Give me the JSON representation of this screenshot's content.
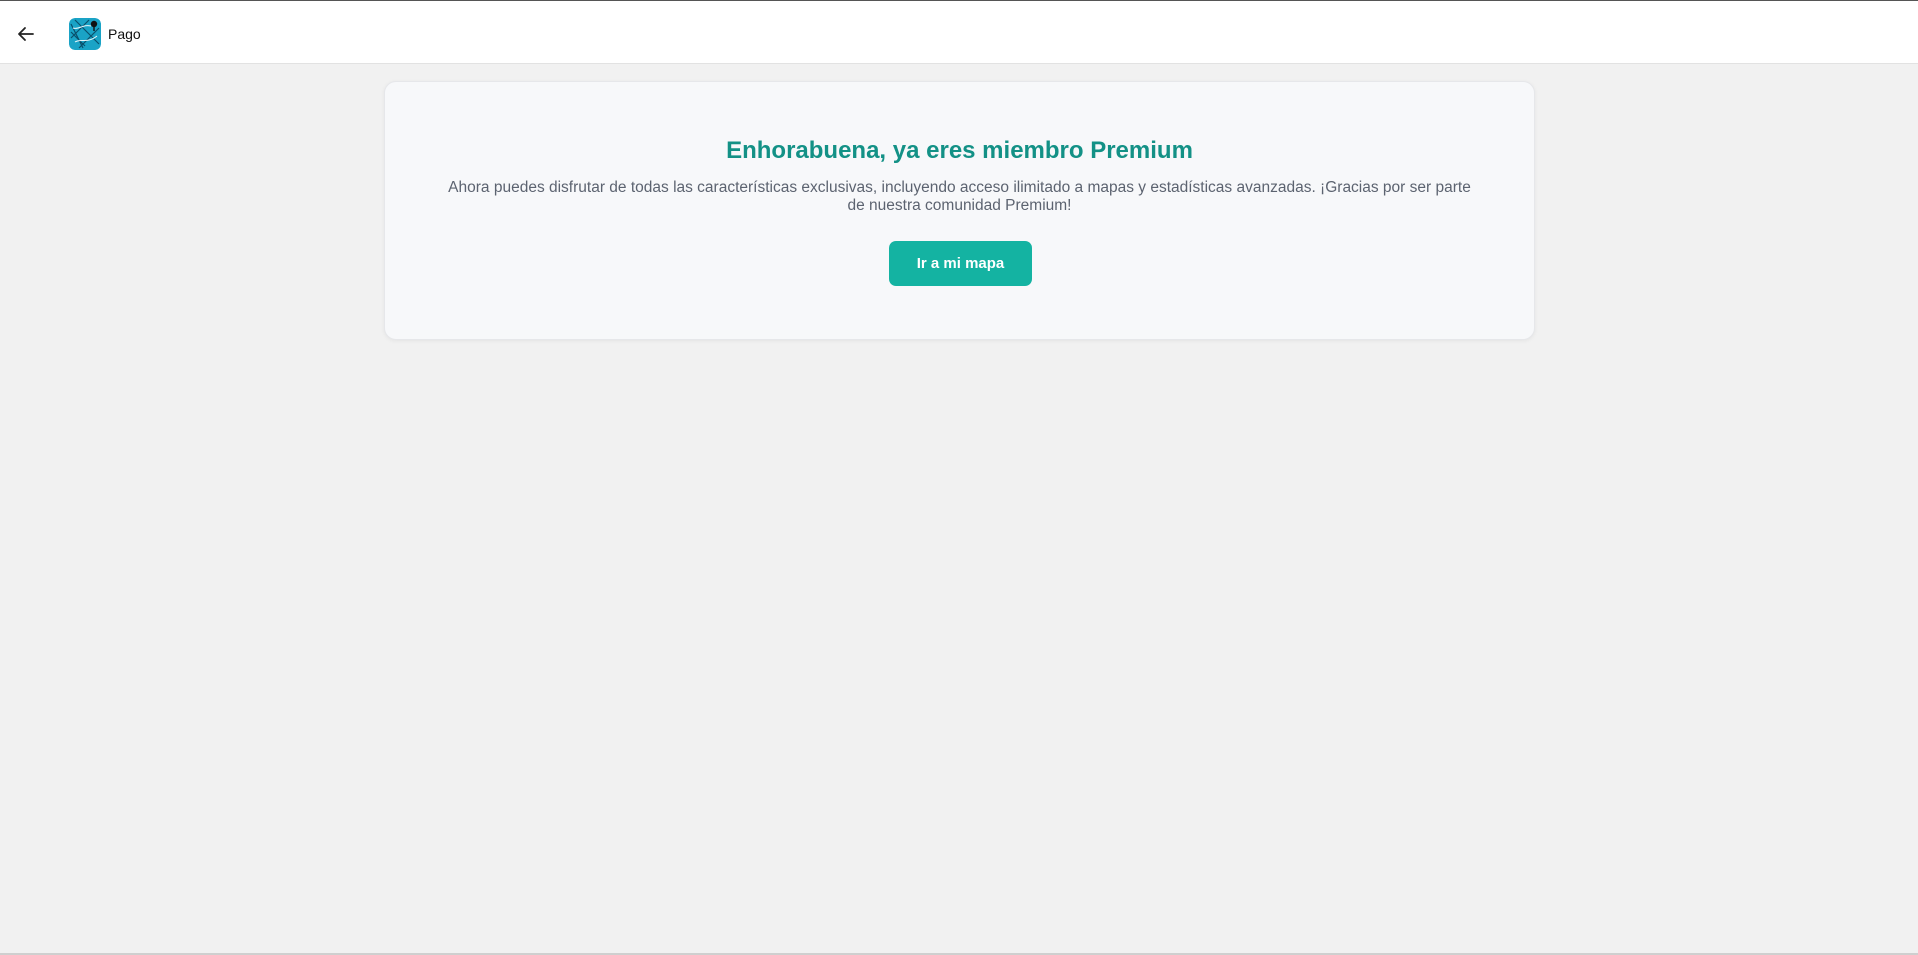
{
  "header": {
    "back_icon": "arrow-left-icon",
    "logo_icon": "map-app-logo-icon",
    "title": "Pago"
  },
  "card": {
    "title": "Enhorabuena, ya eres miembro Premium",
    "description": "Ahora puedes disfrutar de todas las características exclusivas, incluyendo acceso ilimitado a mapas y estadísticas avanzadas. ¡Gracias por ser parte de nuestra comunidad Premium!",
    "button_label": "Ir a mi mapa"
  },
  "colors": {
    "accent": "#14b3a2",
    "title": "#139186",
    "background": "#f1f1f1"
  }
}
